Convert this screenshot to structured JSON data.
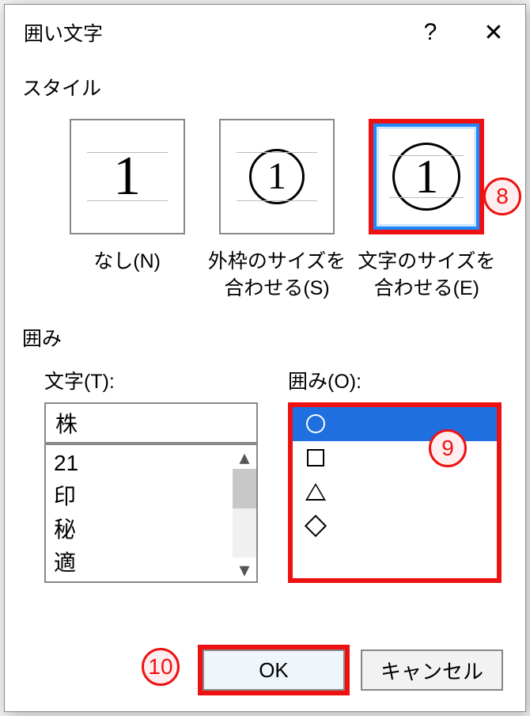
{
  "dialog": {
    "title": "囲い文字"
  },
  "sections": {
    "style_label": "スタイル",
    "enclose_label": "囲み"
  },
  "styles": {
    "none_label": "なし(N)",
    "fit_frame_label": "外枠のサイズを\n合わせる(S)",
    "fit_char_label": "文字のサイズを\n合わせる(E)",
    "glyph": "1"
  },
  "char_field": {
    "label": "文字(T):",
    "value": "株",
    "list": [
      "21",
      "印",
      "秘",
      "適"
    ]
  },
  "shape_field": {
    "label": "囲み(O):",
    "options": [
      "circle",
      "square",
      "triangle",
      "diamond"
    ],
    "selected_index": 0
  },
  "buttons": {
    "ok": "OK",
    "cancel": "キャンセル"
  },
  "callouts": {
    "c8": "8",
    "c9": "9",
    "c10": "10"
  }
}
